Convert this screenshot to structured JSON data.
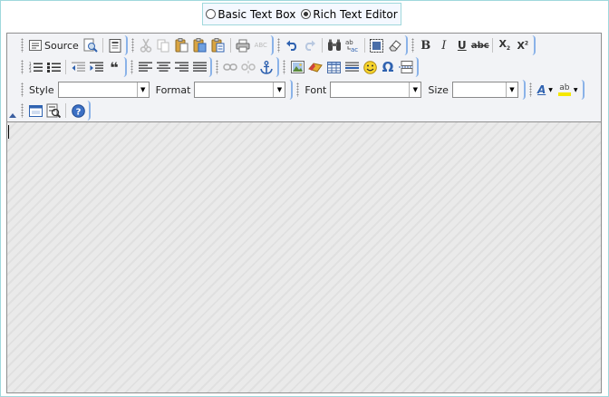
{
  "mode_selector": {
    "options": [
      {
        "label": "Basic Text Box",
        "selected": false
      },
      {
        "label": "Rich Text Editor",
        "selected": true
      }
    ]
  },
  "toolbar": {
    "source_label": "Source",
    "style_label": "Style",
    "format_label": "Format",
    "font_label": "Font",
    "size_label": "Size",
    "style_value": "",
    "format_value": "",
    "font_value": "",
    "size_value": "",
    "spellcheck_glyph": "ABC",
    "font_color_glyph": "A",
    "bg_color_glyph": "ab",
    "bold_glyph": "B",
    "italic_glyph": "I",
    "underline_glyph": "U",
    "strike_glyph": "abc",
    "subscript_glyph": "X",
    "subscript_sub": "2",
    "superscript_glyph": "X",
    "superscript_sup": "2",
    "omega_glyph": "Ω",
    "quote_glyph": "❝",
    "help_glyph": "?"
  },
  "colors": {
    "border": "#a0d8dc",
    "toolbar_bg": "#f2f3f6",
    "group_edge": "#8ab2e8",
    "content_bg": "#eaeaea",
    "icon_blue": "#2f62b0"
  }
}
